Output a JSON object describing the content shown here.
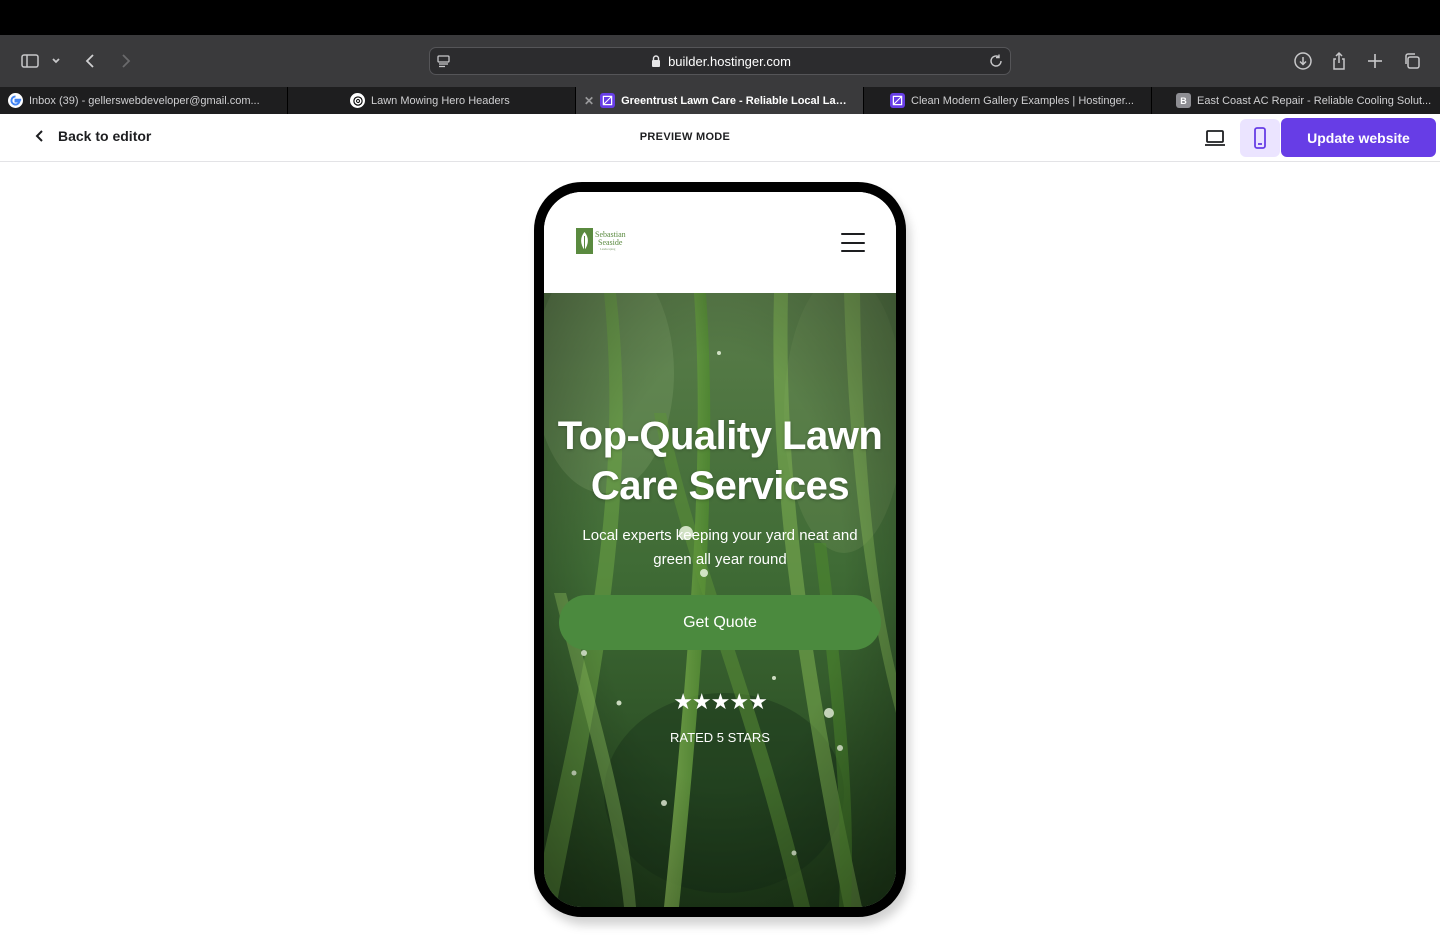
{
  "browser": {
    "url": "builder.hostinger.com",
    "tabs": [
      {
        "title": "Inbox (39) - gellerswebdeveloper@gmail.com...",
        "favicon": "google-icon",
        "active": false
      },
      {
        "title": "Lawn Mowing Hero Headers",
        "favicon": "chatgpt-icon",
        "active": false
      },
      {
        "title": "Greentrust Lawn Care - Reliable Local Lawn S...",
        "favicon": "hostinger-icon",
        "active": true
      },
      {
        "title": "Clean Modern Gallery Examples | Hostinger...",
        "favicon": "hostinger-icon",
        "active": false
      },
      {
        "title": "East Coast AC Repair - Reliable Cooling Solut...",
        "favicon": "b-icon",
        "favicon_letter": "B",
        "active": false
      }
    ]
  },
  "editor": {
    "back_label": "Back to editor",
    "mode_label": "PREVIEW MODE",
    "update_label": "Update website",
    "active_device": "mobile"
  },
  "site": {
    "logo": {
      "line1": "Sebastian",
      "line2": "Seaside",
      "line3": "Landscaping"
    },
    "hero": {
      "title": "Top-Quality Lawn Care Services",
      "subtitle": "Local experts keeping your yard neat and green all year round",
      "cta_label": "Get Quote",
      "stars": "★★★★★",
      "rating_label": "RATED 5 STARS",
      "rating_value": 5
    }
  },
  "colors": {
    "accent": "#673de6",
    "cta": "#4b8a3e",
    "logo_green": "#5a8a3f",
    "toolbar": "#3a3a3c"
  }
}
